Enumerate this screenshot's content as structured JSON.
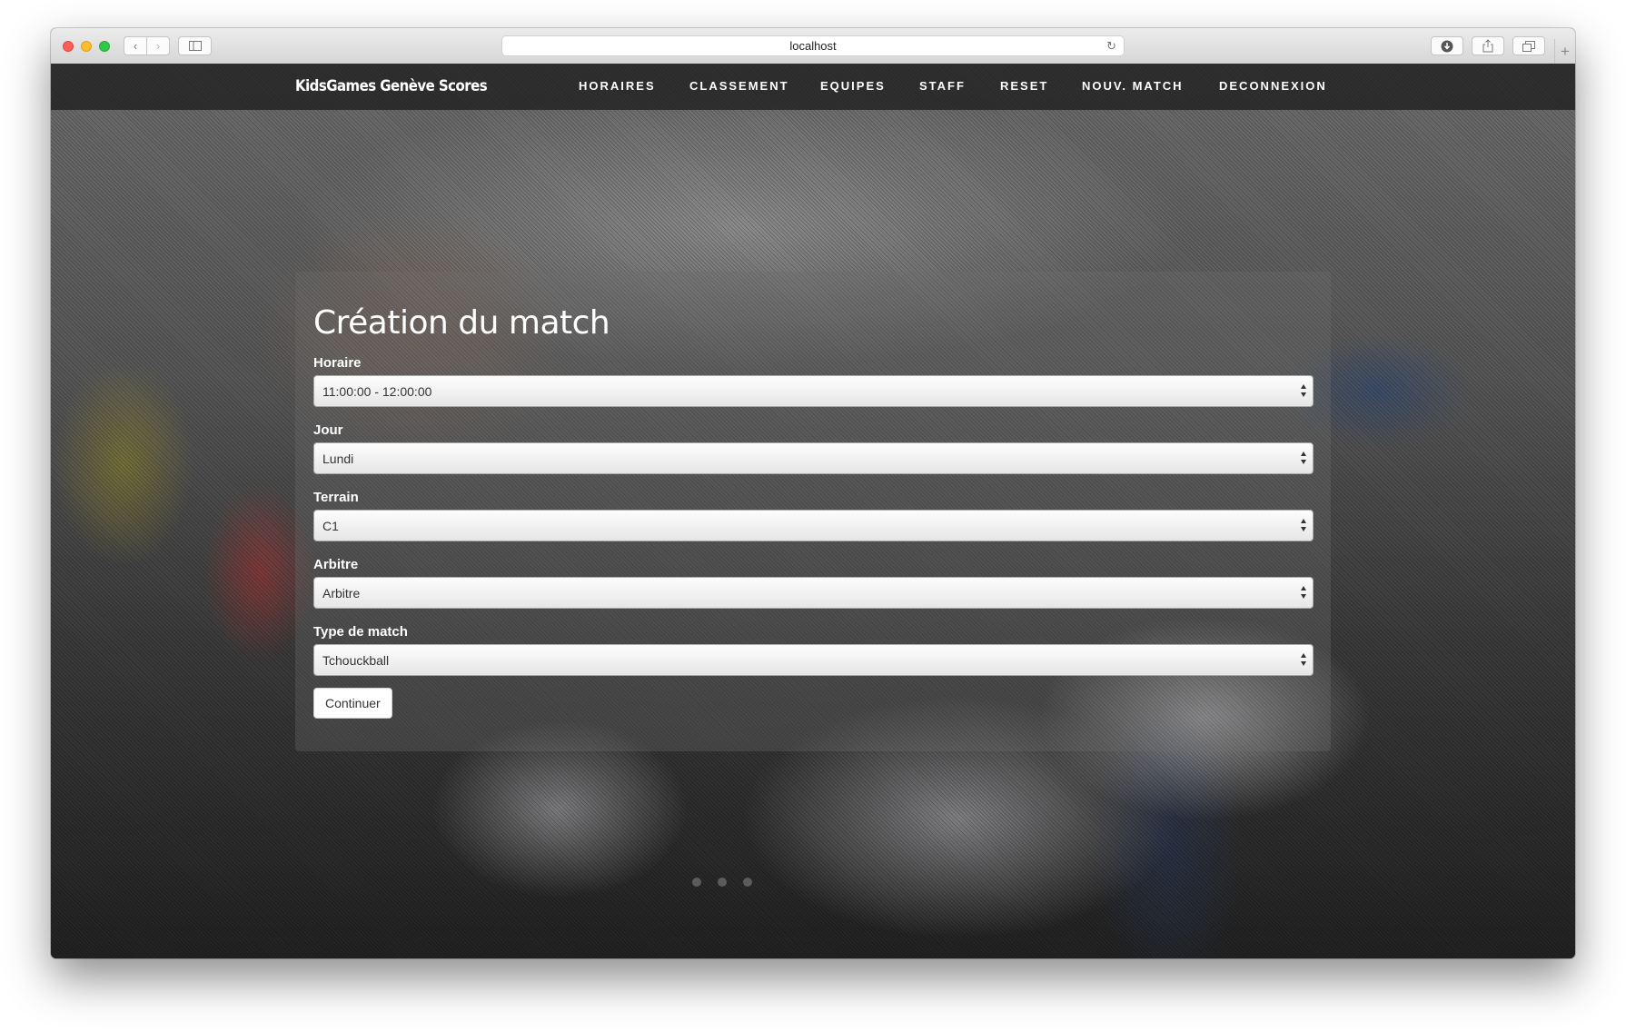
{
  "browser": {
    "address": "localhost"
  },
  "navbar": {
    "brand": "KidsGames Genève Scores",
    "links": [
      "HORAIRES",
      "CLASSEMENT",
      "EQUIPES",
      "STAFF",
      "RESET",
      "NOUV. MATCH",
      "DECONNEXION"
    ]
  },
  "form": {
    "title": "Création du match",
    "fields": [
      {
        "label": "Horaire",
        "value": "11:00:00 - 12:00:00"
      },
      {
        "label": "Jour",
        "value": "Lundi"
      },
      {
        "label": "Terrain",
        "value": "C1"
      },
      {
        "label": "Arbitre",
        "value": "Arbitre"
      },
      {
        "label": "Type de match",
        "value": "Tchouckball"
      }
    ],
    "submit_label": "Continuer"
  },
  "carousel": {
    "slide_count": 3
  }
}
